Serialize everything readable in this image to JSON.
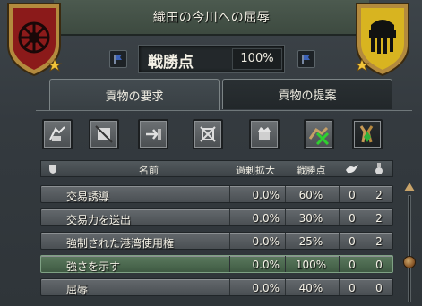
{
  "window": {
    "title": "織田の今川への屈辱"
  },
  "score": {
    "label": "戦勝点",
    "value": "100%"
  },
  "tabs": [
    {
      "label": "貢物の要求",
      "active": true
    },
    {
      "label": "貢物の提案",
      "active": false
    }
  ],
  "actions": [
    {
      "icon": "demand-tribute-icon"
    },
    {
      "icon": "cancel-treaty-icon"
    },
    {
      "icon": "transfer-trade-icon"
    },
    {
      "icon": "release-vassal-icon"
    },
    {
      "icon": "war-reparations-icon"
    },
    {
      "icon": "humiliate-cancel-icon"
    },
    {
      "icon": "gift-icon"
    }
  ],
  "table": {
    "columns": {
      "name": "名前",
      "overextension": "過剰拡大",
      "warscore": "戦勝点",
      "prestige_icon": "dove-icon",
      "other_icon": "medal-icon"
    },
    "rows": [
      {
        "name": "交易誘導",
        "overextension": "0.0%",
        "warscore": "60%",
        "a": "0",
        "b": "2",
        "selected": false
      },
      {
        "name": "交易力を送出",
        "overextension": "0.0%",
        "warscore": "30%",
        "a": "0",
        "b": "2",
        "selected": false
      },
      {
        "name": "強制された港湾使用権",
        "overextension": "0.0%",
        "warscore": "25%",
        "a": "0",
        "b": "2",
        "selected": false
      },
      {
        "name": "強さを示す",
        "overextension": "0.0%",
        "warscore": "100%",
        "a": "0",
        "b": "0",
        "selected": true
      },
      {
        "name": "屈辱",
        "overextension": "0.0%",
        "warscore": "40%",
        "a": "0",
        "b": "0",
        "selected": false
      }
    ]
  },
  "colors": {
    "left_shield": "#8b1a1a",
    "right_shield": "#c9a820",
    "selected_row": "#4f6b52"
  }
}
